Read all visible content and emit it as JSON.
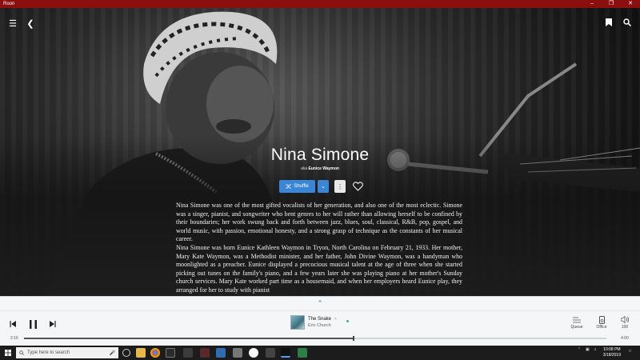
{
  "window": {
    "app_title": "Roon"
  },
  "artist": {
    "name": "Nina Simone",
    "aka_prefix": "aka",
    "aka_name": "Eunice Waymon",
    "shuffle_label": "Shuffle",
    "bio_p1": "Nina Simone was one of the most gifted vocalists of her generation, and also one of the most eclectic. Simone was a singer, pianist, and songwriter who bent genres to her will rather than allowing herself to be confined by their boundaries; her work swung back and forth between jazz, blues, soul, classical, R&B, pop, gospel, and world music, with passion, emotional honesty, and a strong grasp of technique as the constants of her musical career.",
    "bio_p2": "Nina Simone was born Eunice Kathleen Waymon in Tryon, North Carolina on February 21, 1933. Her mother, Mary Kate Waymon, was a Methodist minister, and her father, John Divine Waymon, was a handyman who moonlighted as a preacher. Eunice displayed a precocious musical talent at the age of three when she started picking out tunes on the family's piano, and a few years later she was playing piano at her mother's Sunday church services. Mary Kate worked part time as a housemaid, and when her employers heard Eunice play, they arranged for her to study with pianist"
  },
  "player": {
    "track_title": "The Snake",
    "track_artist": "Eric Church",
    "elapsed": "2:16",
    "duration": "4:00",
    "progress": 0.566,
    "queue_label": "Queue",
    "zone_label": "Office",
    "volume_label": "100"
  },
  "taskbar": {
    "search_placeholder": "Type here to search",
    "time": "10:08 PM",
    "date": "3/18/2019"
  },
  "colors": {
    "titlebar": "#8b0f0f",
    "accent": "#3a86d6",
    "now_playing_dot": "#39b27a"
  }
}
